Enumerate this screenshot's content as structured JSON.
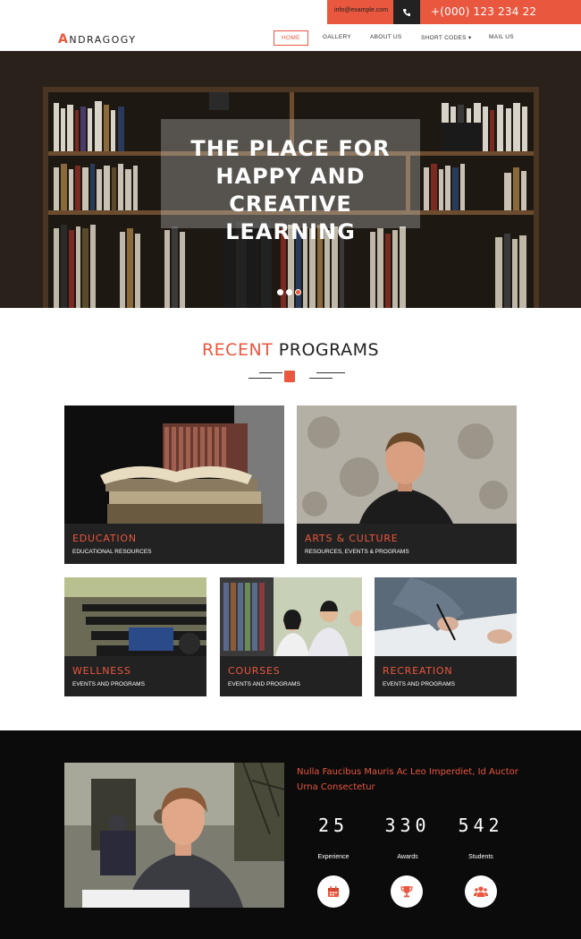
{
  "topbar": {
    "email": "info@example.com",
    "phone": "+(000) 123 234 22",
    "accent": "#e9573f"
  },
  "nav": {
    "logo_first": "A",
    "logo_rest": "NDRAGOGY",
    "items": [
      {
        "label": "Home"
      },
      {
        "label": "Gallery"
      },
      {
        "label": "About Us"
      },
      {
        "label": "Short Codes ▾"
      },
      {
        "label": "Mail Us"
      }
    ]
  },
  "hero": {
    "title_lines": [
      "THE PLACE FOR",
      "HAPPY AND CREATIVE",
      "LEARNING"
    ],
    "active_slide": 3,
    "slide_count": 3
  },
  "programs": {
    "title_accent": "RECENT",
    "title_rest": " PROGRAMS",
    "icon": "book-icon",
    "cards": [
      {
        "title": "EDUCATION",
        "subtitle": "EDUCATIONAL RESOURCES"
      },
      {
        "title": "ARTS & CULTURE",
        "subtitle": "RESOURCES, EVENTS & PROGRAMS"
      },
      {
        "title": "WELLNESS",
        "subtitle": "EVENTS AND PROGRAMS"
      },
      {
        "title": "COURSES",
        "subtitle": "EVENTS AND PROGRAMS"
      },
      {
        "title": "RECREATION",
        "subtitle": "EVENTS AND PROGRAMS"
      }
    ]
  },
  "stats": {
    "heading": "Nulla Faucibus Mauris Ac Leo Imperdiet, Id Auctor Urna Consectetur",
    "items": [
      {
        "number": "25",
        "label": "Experience",
        "icon": "calendar-icon"
      },
      {
        "number": "330",
        "label": "Awards",
        "icon": "trophy-icon"
      },
      {
        "number": "542",
        "label": "Students",
        "icon": "users-icon"
      }
    ]
  }
}
